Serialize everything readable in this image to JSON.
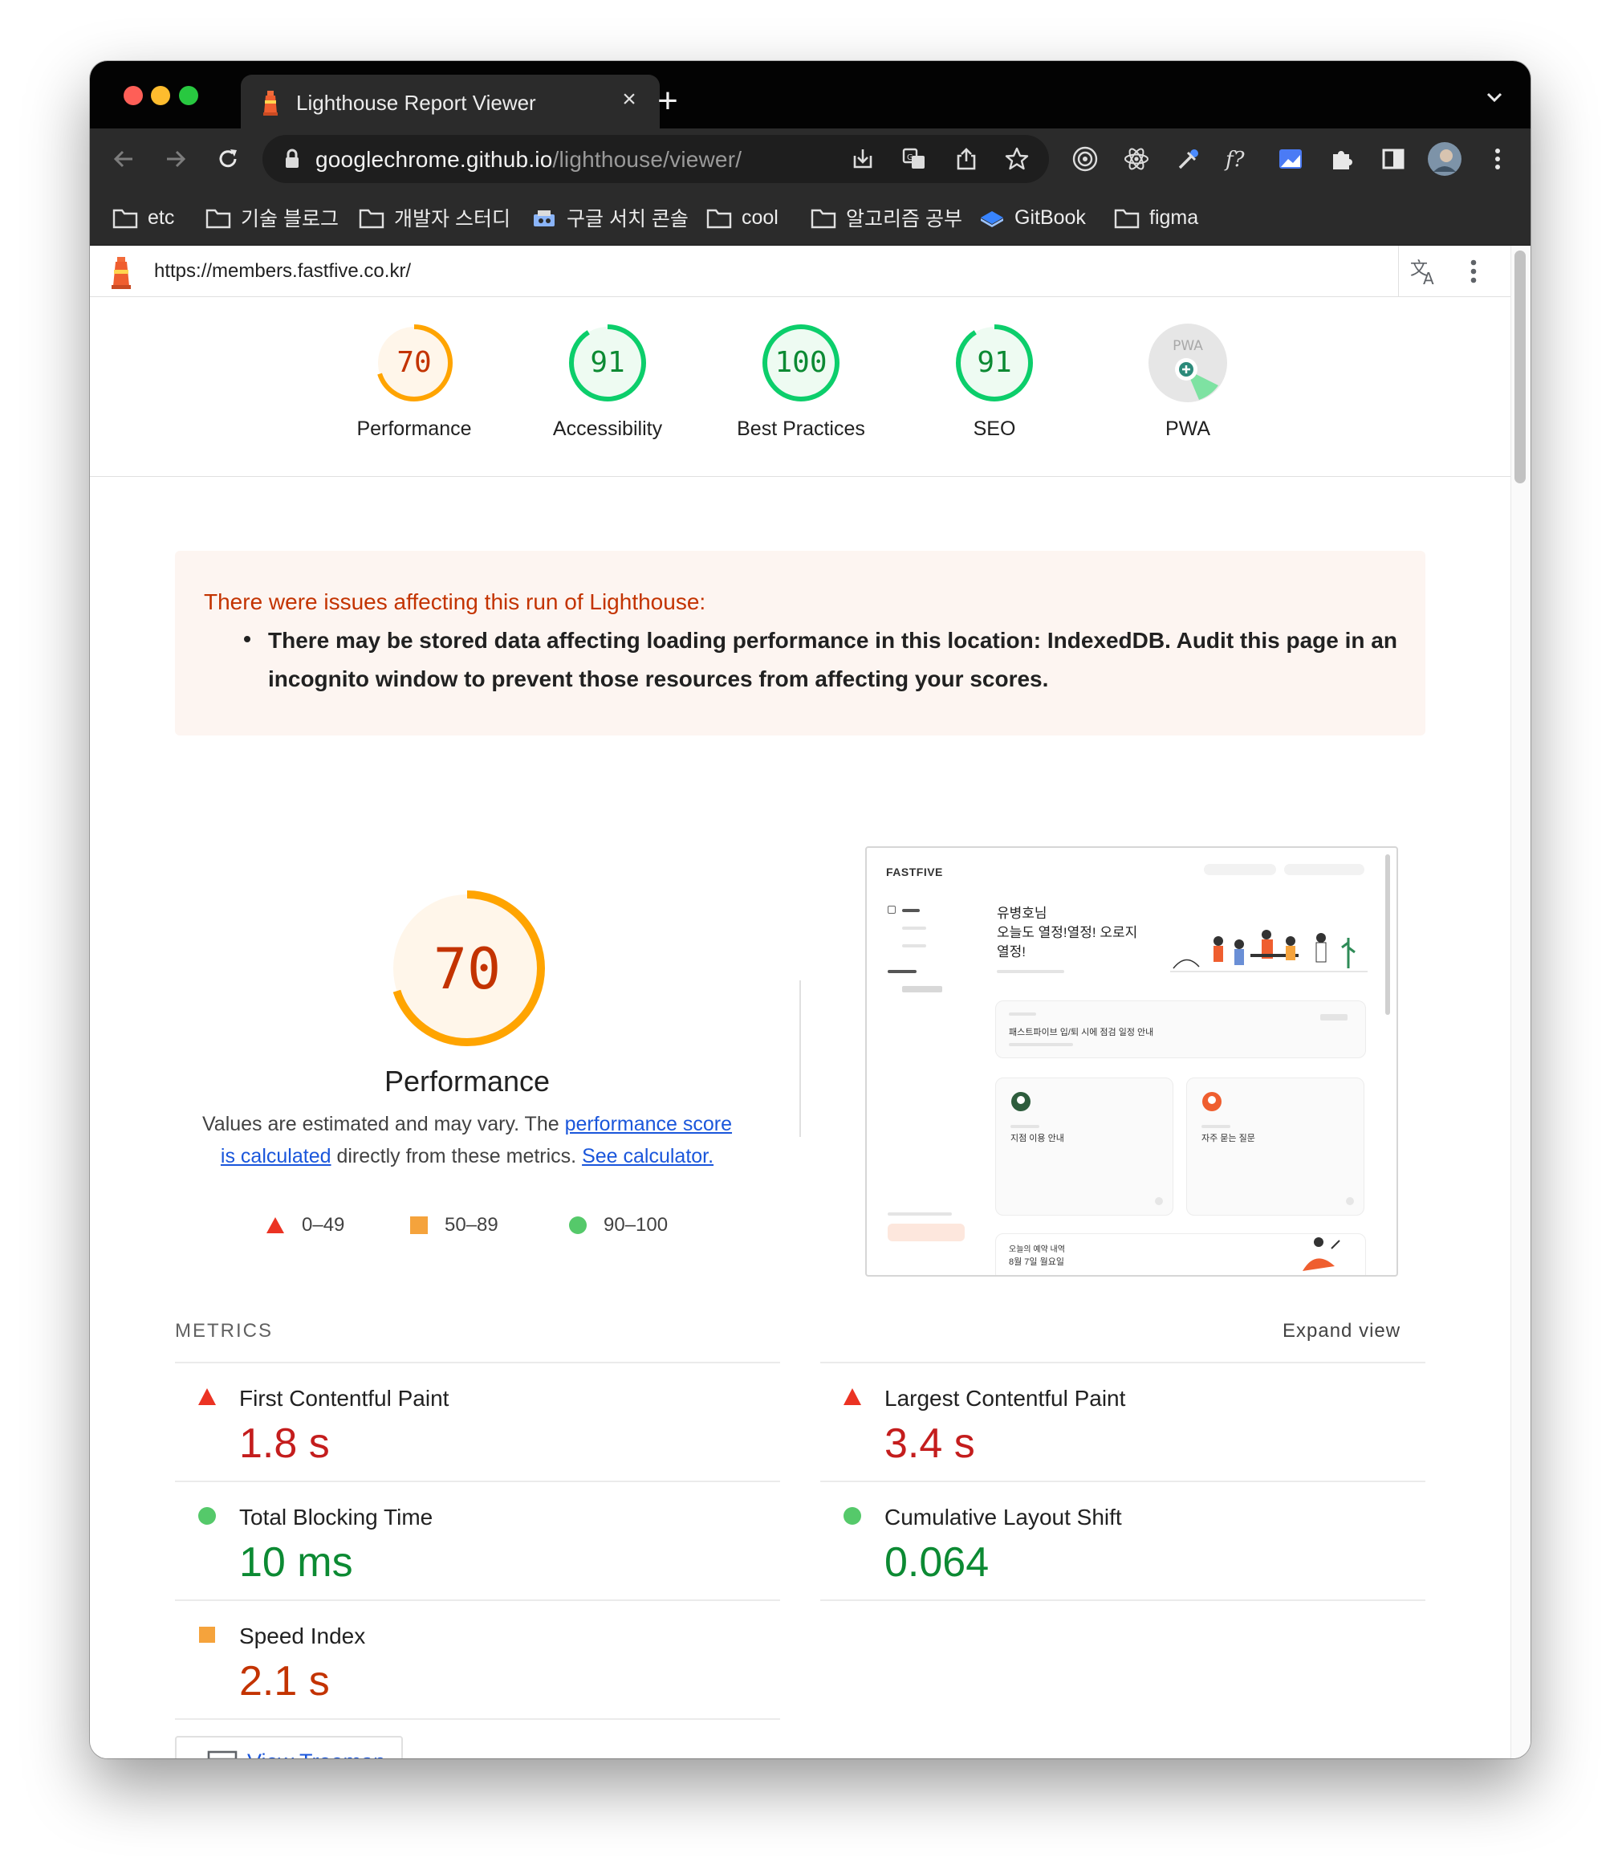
{
  "browser": {
    "tab_title": "Lighthouse Report Viewer",
    "close_glyph": "×",
    "newtab_glyph": "+",
    "url_domain": "googlechrome.github.io",
    "url_path": "/lighthouse/viewer/",
    "bookmarks": [
      "etc",
      "기술 블로그",
      "개발자 스터디",
      "구글 서치 콘솔",
      "cool",
      "알고리즘 공부",
      "GitBook",
      "figma"
    ],
    "icons": [
      "back-arrow-icon",
      "forward-arrow-icon",
      "reload-icon",
      "lock-icon",
      "install-icon",
      "translate-icon",
      "share-icon",
      "star-icon",
      "extensions-icon",
      "side-panel-icon",
      "profile-avatar",
      "more-vert-icon"
    ]
  },
  "viewer": {
    "report_url": "https://members.fastfive.co.kr/"
  },
  "gauges": [
    {
      "label": "Performance",
      "score": "70",
      "value": 70,
      "status": "average"
    },
    {
      "label": "Accessibility",
      "score": "91",
      "value": 91,
      "status": "pass"
    },
    {
      "label": "Best Practices",
      "score": "100",
      "value": 100,
      "status": "pass"
    },
    {
      "label": "SEO",
      "score": "91",
      "value": 91,
      "status": "pass"
    },
    {
      "label": "PWA",
      "score": "PWA",
      "status": "na"
    }
  ],
  "warning": {
    "title": "There were issues affecting this run of Lighthouse:",
    "items": [
      "There may be stored data affecting loading performance in this location: IndexedDB. Audit this page in an incognito window to prevent those resources from affecting your scores."
    ]
  },
  "performance": {
    "score": "70",
    "value": 70,
    "title": "Performance",
    "desc_prefix": "Values are estimated and may vary. The ",
    "desc_link1": "performance score is calculated",
    "desc_middle": " directly from these metrics. ",
    "desc_link2": "See calculator.",
    "legend": [
      {
        "range": "0–49",
        "shape": "triangle",
        "color": "#eb3323"
      },
      {
        "range": "50–89",
        "shape": "square",
        "color": "#f5a33c"
      },
      {
        "range": "90–100",
        "shape": "circle",
        "color": "#55c96a"
      }
    ]
  },
  "thumbnail": {
    "brand": "FASTFIVE",
    "heading_lines": [
      "유병호님",
      "오늘도 열정!열정! 오로지",
      "열정!"
    ],
    "notice": "패스트파이브 입/퇴 시에 점검 일정 안내",
    "card1": "지점 이용 안내",
    "card2": "자주 묻는 질문",
    "footer_line1": "오늘의 예약 내역",
    "footer_line2": "8월 7일 월요일"
  },
  "metrics": {
    "heading": "METRICS",
    "expand_label": "Expand view",
    "items": [
      {
        "label": "First Contentful Paint",
        "value": "1.8 s",
        "status": "fail"
      },
      {
        "label": "Largest Contentful Paint",
        "value": "3.4 s",
        "status": "fail"
      },
      {
        "label": "Total Blocking Time",
        "value": "10 ms",
        "status": "pass"
      },
      {
        "label": "Cumulative Layout Shift",
        "value": "0.064",
        "status": "pass"
      },
      {
        "label": "Speed Index",
        "value": "2.1 s",
        "status": "average"
      }
    ],
    "treemap_label": "View Treemap"
  },
  "colors": {
    "pass": "#0c8a33",
    "pass_ring": "#0cce6b",
    "average": "#c33300",
    "average_ring": "#ffa400",
    "fail_text": "#c41d1d",
    "fail_icon": "#eb3323",
    "square_icon": "#f5a33c",
    "circle_icon": "#55c96a"
  }
}
